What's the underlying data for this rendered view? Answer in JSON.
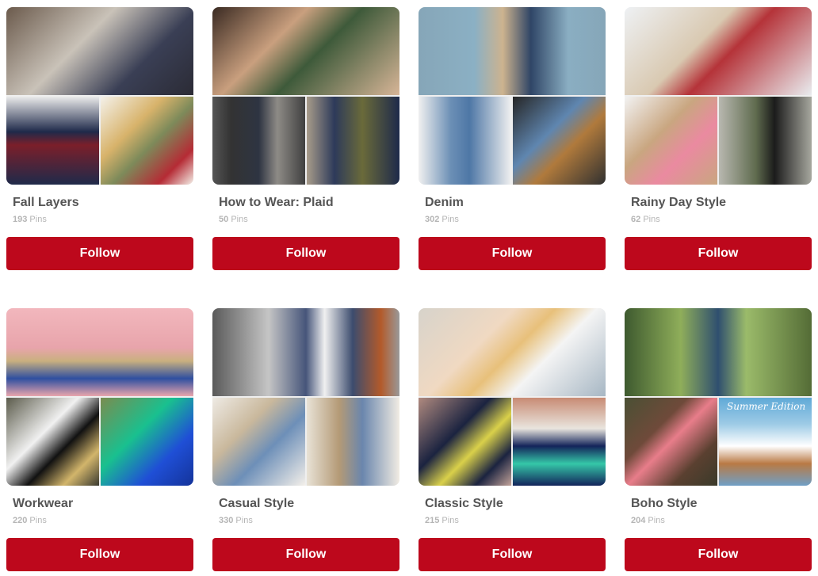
{
  "boards": [
    {
      "name": "Fall Layers",
      "pin_count": "193",
      "pins_label": "Pins",
      "follow_label": "Follow"
    },
    {
      "name": "How to Wear: Plaid",
      "pin_count": "50",
      "pins_label": "Pins",
      "follow_label": "Follow"
    },
    {
      "name": "Denim",
      "pin_count": "302",
      "pins_label": "Pins",
      "follow_label": "Follow"
    },
    {
      "name": "Rainy Day Style",
      "pin_count": "62",
      "pins_label": "Pins",
      "follow_label": "Follow"
    },
    {
      "name": "Workwear",
      "pin_count": "220",
      "pins_label": "Pins",
      "follow_label": "Follow"
    },
    {
      "name": "Casual Style",
      "pin_count": "330",
      "pins_label": "Pins",
      "follow_label": "Follow"
    },
    {
      "name": "Classic Style",
      "pin_count": "215",
      "pins_label": "Pins",
      "follow_label": "Follow"
    },
    {
      "name": "Boho Style",
      "pin_count": "204",
      "pins_label": "Pins",
      "follow_label": "Follow"
    }
  ],
  "cover_text": {
    "boho_style_bottom_right": "Summer Edition"
  },
  "colors": {
    "follow_button": "#bd081c",
    "board_title": "#555555",
    "pin_count": "#b5b5b5"
  }
}
